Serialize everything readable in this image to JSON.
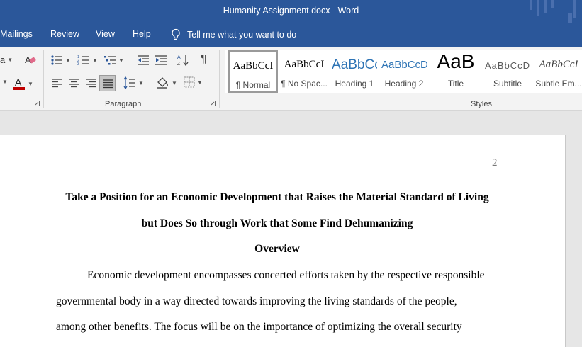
{
  "window": {
    "title": "Humanity Assignment.docx  -  Word"
  },
  "ribbon_tabs": [
    "Mailings",
    "Review",
    "View",
    "Help"
  ],
  "tell_me": {
    "placeholder": "Tell me what you want to do"
  },
  "groups": {
    "paragraph": "Paragraph",
    "styles": "Styles"
  },
  "styles_gallery": [
    {
      "preview": "AaBbCcI",
      "name": "¶ Normal"
    },
    {
      "preview": "AaBbCcI",
      "name": "¶ No Spac..."
    },
    {
      "preview": "AaBbCc",
      "name": "Heading 1"
    },
    {
      "preview": "AaBbCcD",
      "name": "Heading 2"
    },
    {
      "preview": "AaB",
      "name": "Title"
    },
    {
      "preview": "AaBbCcD",
      "name": "Subtitle"
    },
    {
      "preview": "AaBbCcI",
      "name": "Subtle Em..."
    }
  ],
  "colors": {
    "word_blue": "#2b579a",
    "font_color_red": "#c00000"
  },
  "document": {
    "page_number": "2",
    "title_line1": "Take a Position for an Economic Development that Raises the Material Standard of Living",
    "title_line2": "but Does So through Work that Some Find Dehumanizing",
    "section_heading": "Overview",
    "body_lines": [
      "Economic development encompasses concerted efforts taken by the respective responsible",
      "governmental body in a way directed towards improving the living standards of the people,",
      "among other benefits. The focus will be on the importance of optimizing the overall security"
    ]
  }
}
